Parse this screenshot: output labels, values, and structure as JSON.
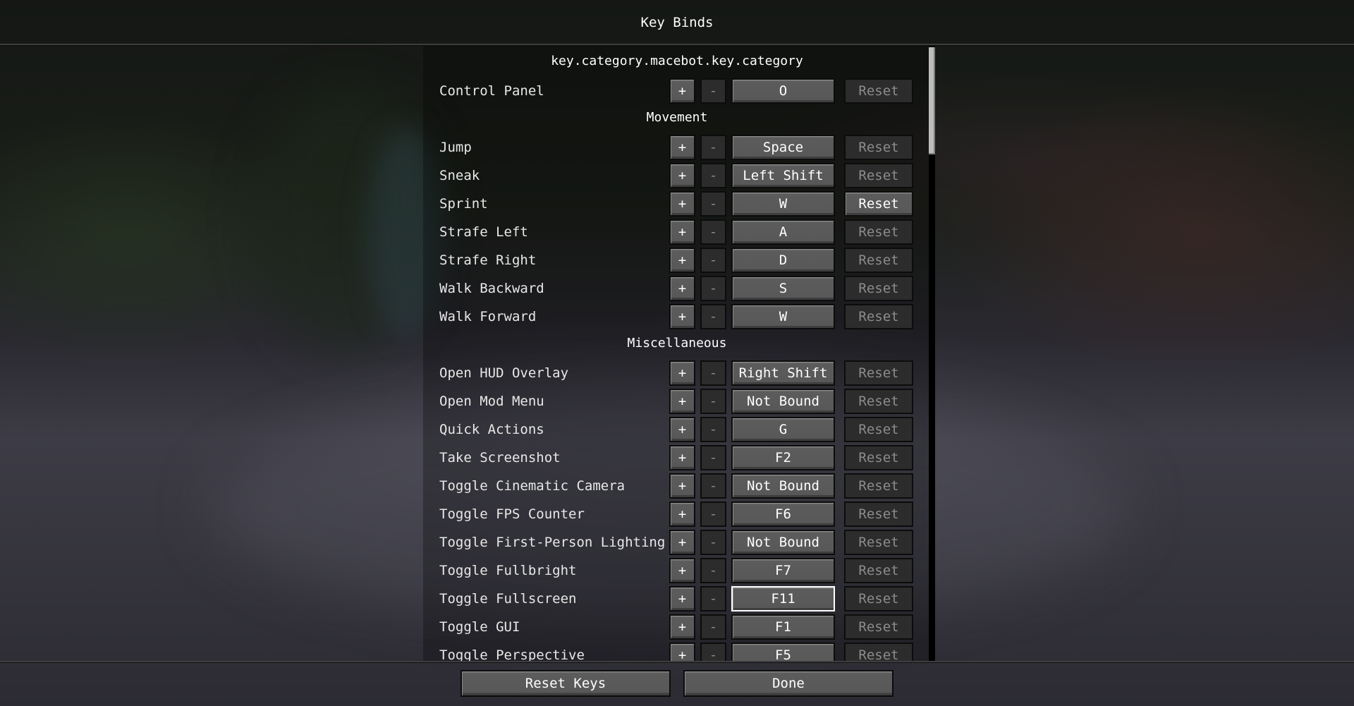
{
  "screen": {
    "title": "Key Binds",
    "accent_focus_color": "#ffffff",
    "list_scroll_fraction": 0.0
  },
  "categories": [
    {
      "label": "key.category.macebot.key.category"
    },
    {
      "label": "Movement"
    },
    {
      "label": "Miscellaneous"
    }
  ],
  "bindings": [
    {
      "name": "Control Panel",
      "key": "O",
      "plus": "+",
      "minus": "-",
      "reset": "Reset",
      "reset_enabled": false
    },
    {
      "name": "Jump",
      "key": "Space",
      "plus": "+",
      "minus": "-",
      "reset": "Reset",
      "reset_enabled": false
    },
    {
      "name": "Sneak",
      "key": "Left Shift",
      "plus": "+",
      "minus": "-",
      "reset": "Reset",
      "reset_enabled": false
    },
    {
      "name": "Sprint",
      "key": "W",
      "plus": "+",
      "minus": "-",
      "reset": "Reset",
      "reset_enabled": true
    },
    {
      "name": "Strafe Left",
      "key": "A",
      "plus": "+",
      "minus": "-",
      "reset": "Reset",
      "reset_enabled": false
    },
    {
      "name": "Strafe Right",
      "key": "D",
      "plus": "+",
      "minus": "-",
      "reset": "Reset",
      "reset_enabled": false
    },
    {
      "name": "Walk Backward",
      "key": "S",
      "plus": "+",
      "minus": "-",
      "reset": "Reset",
      "reset_enabled": false
    },
    {
      "name": "Walk Forward",
      "key": "W",
      "plus": "+",
      "minus": "-",
      "reset": "Reset",
      "reset_enabled": false
    },
    {
      "name": "Open HUD Overlay",
      "key": "Right Shift",
      "plus": "+",
      "minus": "-",
      "reset": "Reset",
      "reset_enabled": false
    },
    {
      "name": "Open Mod Menu",
      "key": "Not Bound",
      "plus": "+",
      "minus": "-",
      "reset": "Reset",
      "reset_enabled": false
    },
    {
      "name": "Quick Actions",
      "key": "G",
      "plus": "+",
      "minus": "-",
      "reset": "Reset",
      "reset_enabled": false
    },
    {
      "name": "Take Screenshot",
      "key": "F2",
      "plus": "+",
      "minus": "-",
      "reset": "Reset",
      "reset_enabled": false
    },
    {
      "name": "Toggle Cinematic Camera",
      "key": "Not Bound",
      "plus": "+",
      "minus": "-",
      "reset": "Reset",
      "reset_enabled": false
    },
    {
      "name": "Toggle FPS Counter",
      "key": "F6",
      "plus": "+",
      "minus": "-",
      "reset": "Reset",
      "reset_enabled": false
    },
    {
      "name": "Toggle First-Person Lighting",
      "key": "Not Bound",
      "plus": "+",
      "minus": "-",
      "reset": "Reset",
      "reset_enabled": false
    },
    {
      "name": "Toggle Fullbright",
      "key": "F7",
      "plus": "+",
      "minus": "-",
      "reset": "Reset",
      "reset_enabled": false
    },
    {
      "name": "Toggle Fullscreen",
      "key": "F11",
      "plus": "+",
      "minus": "-",
      "reset": "Reset",
      "reset_enabled": false,
      "focused": true
    },
    {
      "name": "Toggle GUI",
      "key": "F1",
      "plus": "+",
      "minus": "-",
      "reset": "Reset",
      "reset_enabled": false
    },
    {
      "name": "Toggle Perspective",
      "key": "F5",
      "plus": "+",
      "minus": "-",
      "reset": "Reset",
      "reset_enabled": false
    }
  ],
  "footer": {
    "reset_keys_label": "Reset Keys",
    "done_label": "Done"
  }
}
